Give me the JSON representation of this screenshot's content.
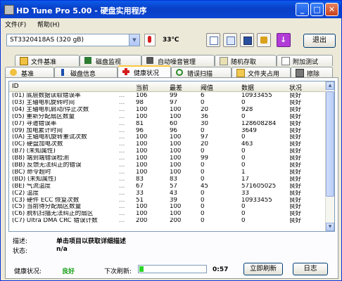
{
  "window": {
    "title": "HD Tune Pro 5.00 - 硬盘实用程序",
    "minimize_label": "_",
    "maximize_label": "□",
    "close_label": "✕"
  },
  "menu": {
    "file": "文件(F)",
    "help": "帮助(H)"
  },
  "toolbar": {
    "drive": "ST3320418AS (320 gB)",
    "temperature": "33℃",
    "exit_label": "退出"
  },
  "tabs_row1": [
    {
      "label": "文件基准"
    },
    {
      "label": "磁盘监视"
    },
    {
      "label": "自动噪音管理"
    },
    {
      "label": "随机存取"
    },
    {
      "label": "附加测试"
    }
  ],
  "tabs_row2": [
    {
      "label": "基准"
    },
    {
      "label": "磁盘信息"
    },
    {
      "label": "健康状况"
    },
    {
      "label": "错误扫描"
    },
    {
      "label": "文件夹占用"
    },
    {
      "label": "擦除"
    }
  ],
  "table": {
    "headers": {
      "id": "ID",
      "current": "当前",
      "worst": "最差",
      "threshold": "阈值",
      "data": "数据",
      "status": "状况"
    },
    "rows": [
      {
        "id": "(01) 底层数据读取错误率",
        "dots": "...",
        "current": "106",
        "worst": "99",
        "threshold": "6",
        "data": "10933455",
        "status": "良好"
      },
      {
        "id": "(03) 主轴电机旋转时间",
        "dots": "...",
        "current": "98",
        "worst": "97",
        "threshold": "0",
        "data": "0",
        "status": "良好"
      },
      {
        "id": "(04) 主轴电机启动/停止次数",
        "dots": "...",
        "current": "100",
        "worst": "100",
        "threshold": "20",
        "data": "928",
        "status": "良好"
      },
      {
        "id": "(05) 重新分配扇区数量",
        "dots": "...",
        "current": "100",
        "worst": "100",
        "threshold": "36",
        "data": "0",
        "status": "良好"
      },
      {
        "id": "(07) 寻道错误率",
        "dots": "...",
        "current": "81",
        "worst": "60",
        "threshold": "30",
        "data": "128608284",
        "status": "良好"
      },
      {
        "id": "(09) 加电累计时间",
        "dots": "...",
        "current": "96",
        "worst": "96",
        "threshold": "0",
        "data": "3649",
        "status": "良好"
      },
      {
        "id": "(0A) 主轴电机旋转重试次数",
        "dots": "...",
        "current": "100",
        "worst": "100",
        "threshold": "97",
        "data": "0",
        "status": "良好"
      },
      {
        "id": "(0C) 硬盘加电次数",
        "dots": "...",
        "current": "100",
        "worst": "100",
        "threshold": "20",
        "data": "463",
        "status": "良好"
      },
      {
        "id": "(B7) (未知属性)",
        "dots": "...",
        "current": "100",
        "worst": "100",
        "threshold": "0",
        "data": "0",
        "status": "良好"
      },
      {
        "id": "(B8) 端到端错误检测",
        "dots": "...",
        "current": "100",
        "worst": "100",
        "threshold": "99",
        "data": "0",
        "status": "良好"
      },
      {
        "id": "(BB) 反馈无法纠正的错误",
        "dots": "...",
        "current": "100",
        "worst": "100",
        "threshold": "0",
        "data": "0",
        "status": "良好"
      },
      {
        "id": "(BC) 命令超时",
        "dots": "...",
        "current": "100",
        "worst": "100",
        "threshold": "0",
        "data": "1",
        "status": "良好"
      },
      {
        "id": "(BD) (未知属性)",
        "dots": "...",
        "current": "83",
        "worst": "83",
        "threshold": "0",
        "data": "17",
        "status": "良好"
      },
      {
        "id": "(BE) 气流温度",
        "dots": "...",
        "current": "67",
        "worst": "57",
        "threshold": "45",
        "data": "571605025",
        "status": "良好"
      },
      {
        "id": "(C2) 温度",
        "dots": "...",
        "current": "33",
        "worst": "43",
        "threshold": "0",
        "data": "33",
        "status": "良好"
      },
      {
        "id": "(C3) 硬件 ECC 恢复次数",
        "dots": "...",
        "current": "51",
        "worst": "39",
        "threshold": "0",
        "data": "10933455",
        "status": "良好"
      },
      {
        "id": "(C5) 当前待分配扇区数量",
        "dots": "...",
        "current": "100",
        "worst": "100",
        "threshold": "0",
        "data": "0",
        "status": "良好"
      },
      {
        "id": "(C6) 脱机扫描无法纠正的扇区",
        "dots": "...",
        "current": "100",
        "worst": "100",
        "threshold": "0",
        "data": "0",
        "status": "良好"
      },
      {
        "id": "(C7) Ultra DMA CRC 错误计数",
        "dots": "...",
        "current": "200",
        "worst": "200",
        "threshold": "0",
        "data": "0",
        "status": "良好"
      }
    ]
  },
  "description": {
    "label": "描述:",
    "value": "单击项目以获取详细描述",
    "state_label": "状态:",
    "state_value": "n/a"
  },
  "footer": {
    "health_label": "健康状况:",
    "health_value": "良好",
    "next_refresh_label": "下次刷新:",
    "progress": 0.06,
    "time": "0:57",
    "refresh_label": "立即刷新",
    "log_label": "日志"
  },
  "colors": {
    "title_bar": "#0a3fc6",
    "health_good": "#19a019",
    "progress_fill": "#2bd32b"
  }
}
